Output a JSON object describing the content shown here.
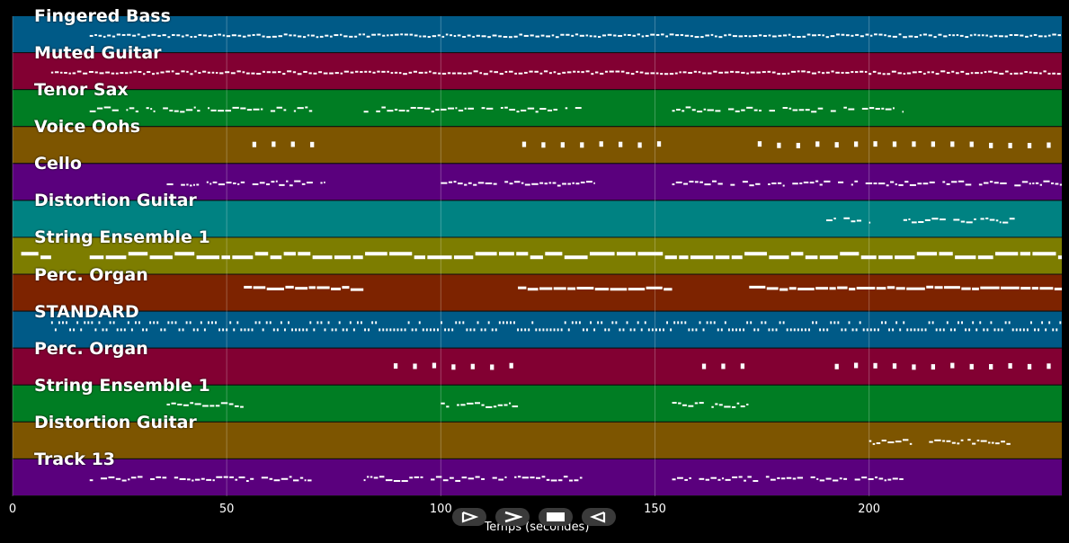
{
  "tracks": [
    {
      "name": "Fingered Bass",
      "color": "#005a87",
      "pattern": "dense-small",
      "ranges": [
        [
          18,
          245
        ]
      ]
    },
    {
      "name": "Muted Guitar",
      "color": "#820032",
      "pattern": "dense-small",
      "ranges": [
        [
          9,
          245
        ]
      ]
    },
    {
      "name": "Tenor Sax",
      "color": "#007d23",
      "pattern": "phrase",
      "ranges": [
        [
          18,
          70
        ],
        [
          82,
          133
        ],
        [
          154,
          208
        ]
      ]
    },
    {
      "name": "Voice Oohs",
      "color": "#7d5500",
      "pattern": "block",
      "ranges": [
        [
          56,
          72
        ],
        [
          119,
          154
        ],
        [
          174,
          245
        ]
      ]
    },
    {
      "name": "Cello",
      "color": "#5a007d",
      "pattern": "phrase",
      "ranges": [
        [
          36,
          73
        ],
        [
          100,
          136
        ],
        [
          154,
          245
        ]
      ]
    },
    {
      "name": "Distortion Guitar",
      "color": "#008282",
      "pattern": "phrase",
      "ranges": [
        [
          190,
          200
        ],
        [
          208,
          225
        ],
        [
          226,
          234
        ]
      ]
    },
    {
      "name": "String Ensemble 1",
      "color": "#7d7d00",
      "pattern": "thick",
      "ranges": [
        [
          2,
          9
        ],
        [
          18,
          245
        ]
      ]
    },
    {
      "name": "Perc. Organ",
      "color": "#7d2300",
      "pattern": "long",
      "ranges": [
        [
          54,
          82
        ],
        [
          118,
          154
        ],
        [
          172,
          245
        ]
      ]
    },
    {
      "name": "STANDARD",
      "color": "#005a87",
      "pattern": "drum",
      "ranges": [
        [
          9,
          245
        ]
      ]
    },
    {
      "name": "Perc. Organ",
      "color": "#820032",
      "pattern": "block",
      "ranges": [
        [
          89,
          118
        ],
        [
          161,
          172
        ],
        [
          192,
          245
        ]
      ]
    },
    {
      "name": "String Ensemble 1",
      "color": "#007d23",
      "pattern": "phrase",
      "ranges": [
        [
          36,
          54
        ],
        [
          100,
          118
        ],
        [
          154,
          172
        ]
      ]
    },
    {
      "name": "Distortion Guitar",
      "color": "#7d5500",
      "pattern": "phrase",
      "ranges": [
        [
          200,
          210
        ],
        [
          214,
          222
        ],
        [
          223,
          233
        ]
      ]
    },
    {
      "name": "Track 13",
      "color": "#5a007d",
      "pattern": "phrase",
      "ranges": [
        [
          18,
          70
        ],
        [
          82,
          133
        ],
        [
          154,
          208
        ]
      ]
    }
  ],
  "x_axis": {
    "label": "Temps (secondes)",
    "ticks": [
      0,
      50,
      100,
      150,
      200
    ],
    "range": [
      0,
      245
    ]
  },
  "controls": [
    {
      "name": "play-button",
      "icon": "play-icon"
    },
    {
      "name": "fast-forward-button",
      "icon": "fast-forward-icon"
    },
    {
      "name": "stop-button",
      "icon": "stop-icon"
    },
    {
      "name": "rewind-button",
      "icon": "rewind-icon"
    }
  ]
}
